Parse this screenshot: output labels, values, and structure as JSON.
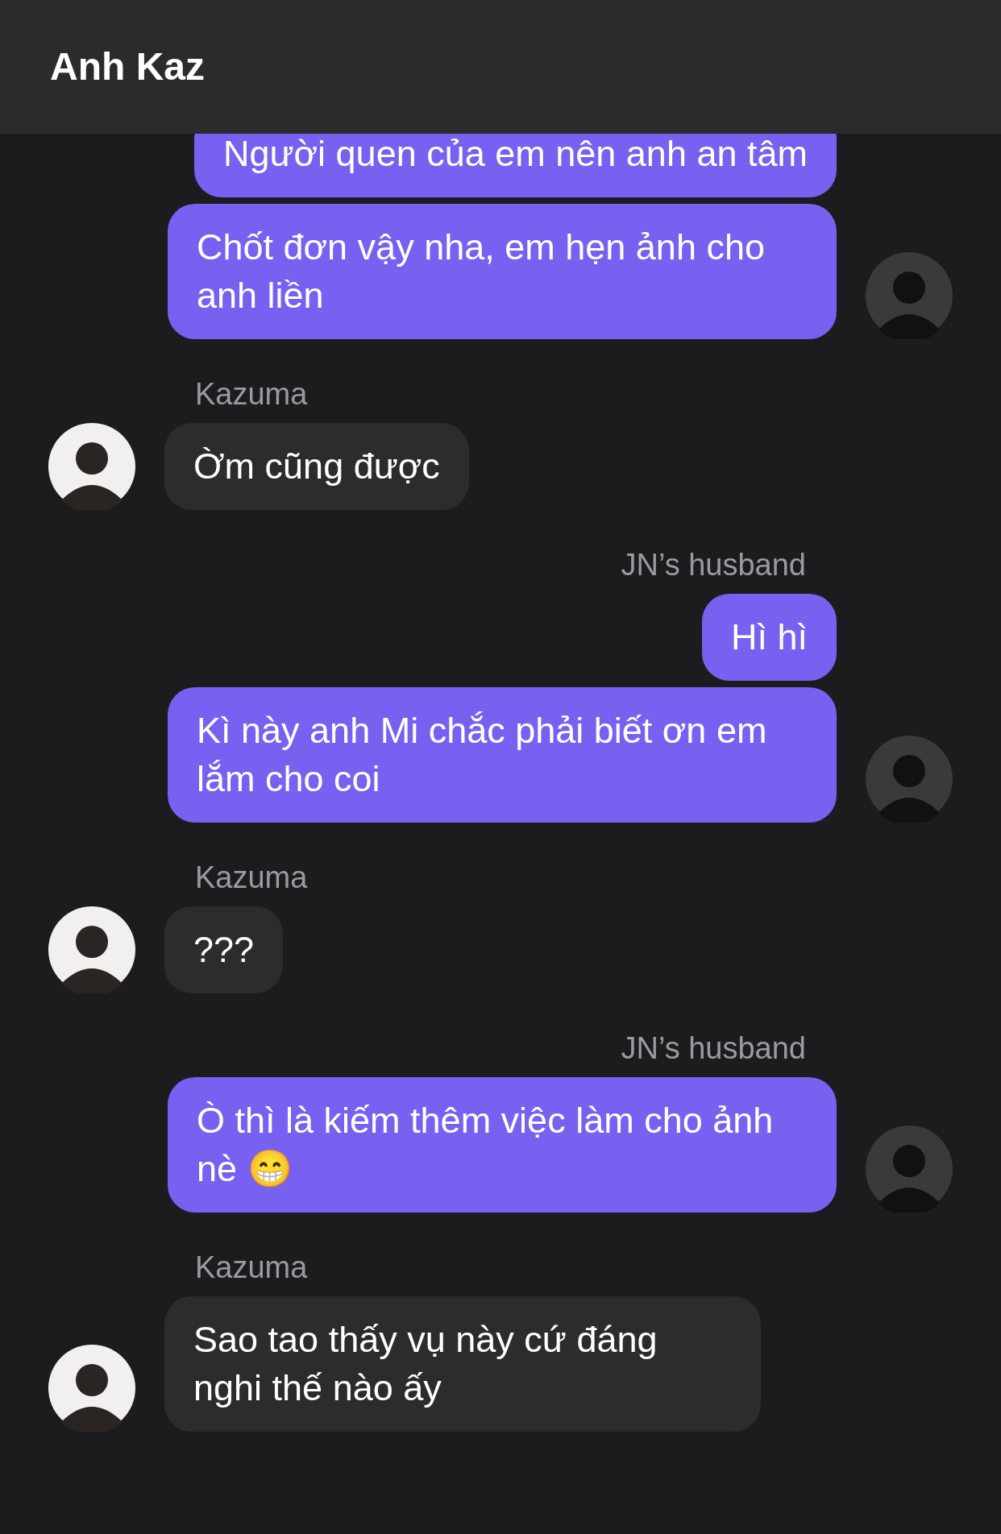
{
  "header": {
    "title": "Anh Kaz"
  },
  "groups": [
    {
      "kind": "out",
      "bubbles": [
        "Người quen của em nên anh an tâm",
        "Chốt đơn vậy nha, em hẹn ảnh cho anh liền"
      ]
    },
    {
      "kind": "in",
      "sender": "Kazuma",
      "bubbles": [
        "Ờm cũng được"
      ]
    },
    {
      "kind": "out",
      "sender": "JN’s husband",
      "bubbles": [
        "Hì hì",
        "Kì này anh Mi chắc phải biết ơn em lắm cho coi"
      ]
    },
    {
      "kind": "in",
      "sender": "Kazuma",
      "bubbles": [
        "???"
      ]
    },
    {
      "kind": "out",
      "sender": "JN’s husband",
      "bubbles": [
        "Ò thì là kiếm thêm việc làm cho ảnh nè 😁"
      ]
    },
    {
      "kind": "in",
      "sender": "Kazuma",
      "bubbles": [
        "Sao tao thấy vụ này cứ đáng nghi thế nào ấy"
      ]
    }
  ]
}
